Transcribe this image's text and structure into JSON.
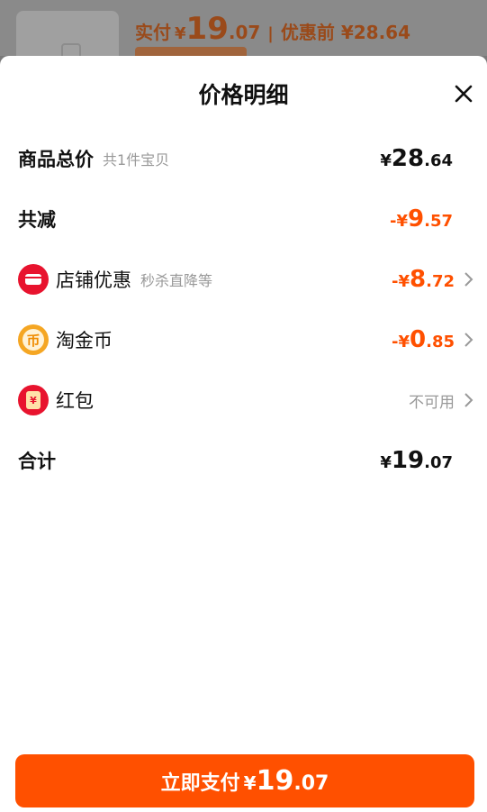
{
  "background": {
    "paid_label": "实付",
    "paid_currency": "¥",
    "paid_int": "19",
    "paid_dec": ".07",
    "separator": "|",
    "before_label": "优惠前 ¥28.64"
  },
  "sheet": {
    "title": "价格明细"
  },
  "rows": {
    "total": {
      "label": "商品总价",
      "sub": "共1件宝贝",
      "currency": "¥",
      "int": "28",
      "dec": ".64"
    },
    "reduction": {
      "label": "共减",
      "sign": "-",
      "currency": "¥",
      "int": "9",
      "dec": ".57"
    },
    "store": {
      "label": "店铺优惠",
      "sub": "秒杀直降等",
      "sign": "-",
      "currency": "¥",
      "int": "8",
      "dec": ".72"
    },
    "coins": {
      "label": "淘金币",
      "sign": "-",
      "currency": "¥",
      "int": "0",
      "dec": ".85",
      "icon_glyph": "币"
    },
    "redpacket": {
      "label": "红包",
      "status": "不可用",
      "icon_glyph": "¥"
    },
    "sum": {
      "label": "合计",
      "currency": "¥",
      "int": "19",
      "dec": ".07"
    }
  },
  "pay_button": {
    "label": "立即支付",
    "currency": "¥",
    "int": "19",
    "dec": ".07"
  },
  "colors": {
    "accent": "#ff5000",
    "store_icon": "#e8132e",
    "coin_icon": "#f5a623",
    "redpacket_icon": "#e8132e"
  }
}
